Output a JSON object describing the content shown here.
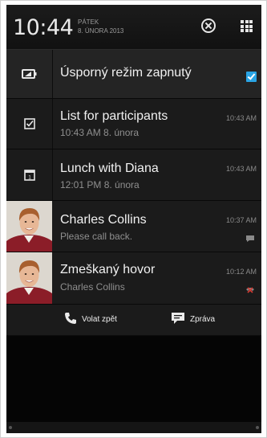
{
  "status": {
    "time": "10:44",
    "weekday": "PÁTEK",
    "date": "8. ÚNORA 2013",
    "icons": [
      "close-circle-icon",
      "grid-apps-icon"
    ]
  },
  "power_saver": {
    "label": "Úsporný režim zapnutý",
    "checked": true,
    "icon": "battery-leaf-icon",
    "accent": "#2aa4e4"
  },
  "notifications": [
    {
      "title": "List for participants",
      "subtitle": "10:43 AM 8. února",
      "time": "10:43 AM",
      "icon": "task-check-icon"
    },
    {
      "title": "Lunch with Diana",
      "subtitle": "12:01 PM 8. února",
      "time": "10:43 AM",
      "icon": "calendar-icon"
    },
    {
      "title": "Charles Collins",
      "subtitle": "Please call back.",
      "time": "10:37 AM",
      "icon": "message-icon"
    },
    {
      "title": "Zmeškaný hovor",
      "subtitle": "Charles Collins",
      "time": "10:12 AM",
      "icon": "missed-call-icon"
    }
  ],
  "actions": {
    "call_back": "Volat zpět",
    "message": "Zpráva"
  }
}
